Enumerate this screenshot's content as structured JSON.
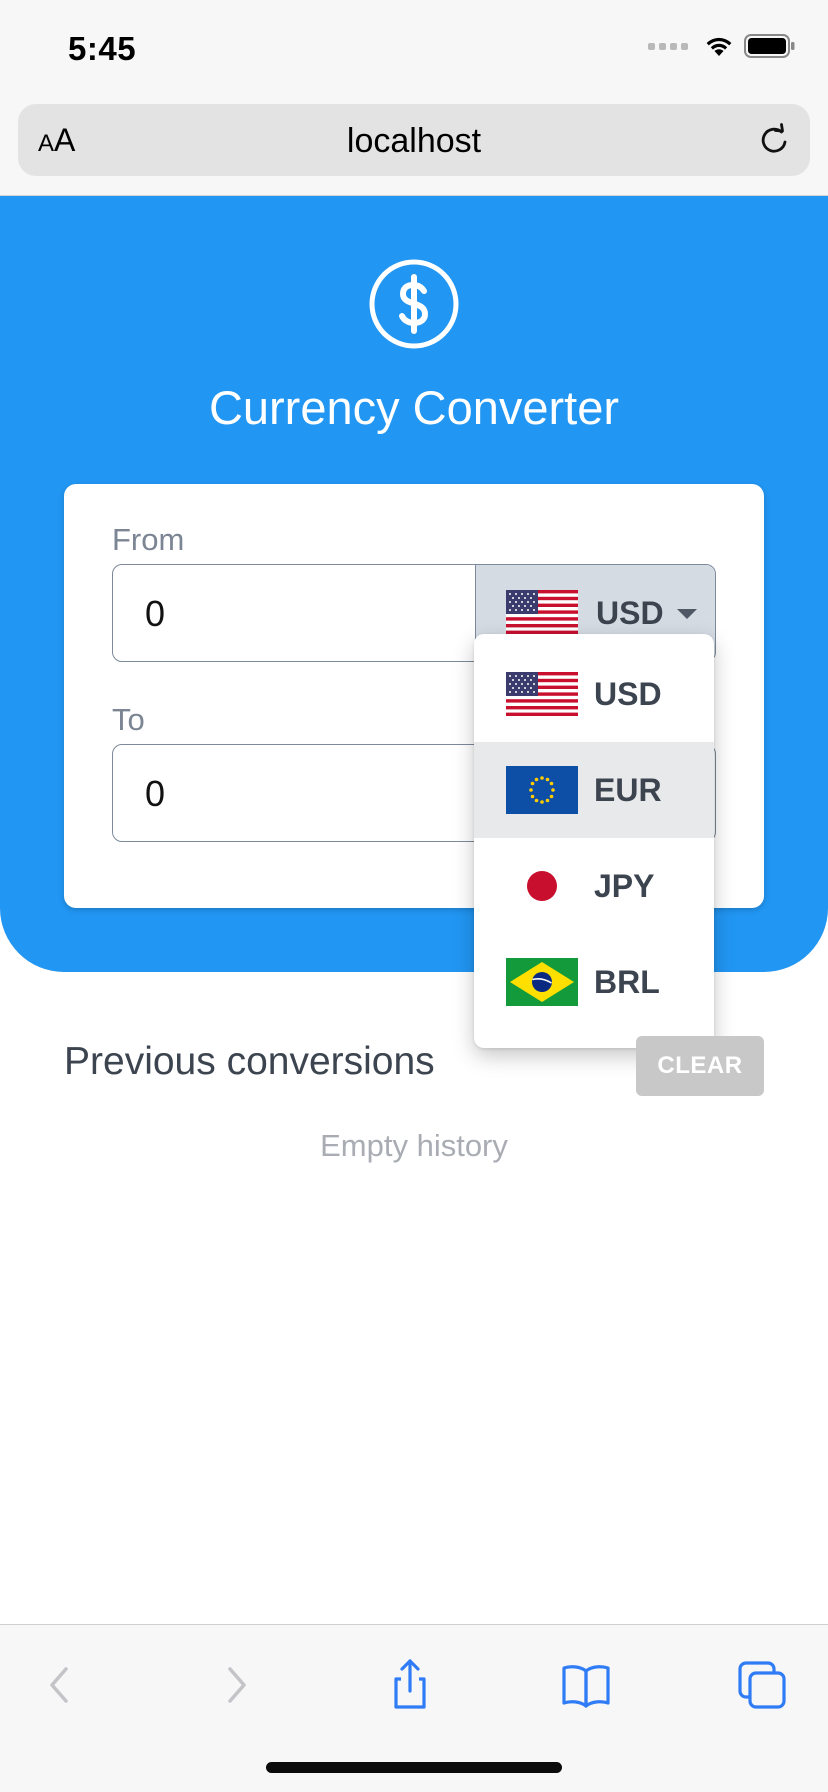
{
  "status_bar": {
    "time": "5:45"
  },
  "browser": {
    "aa_small": "A",
    "aa_large": "A",
    "url": "localhost"
  },
  "app": {
    "title": "Currency Converter"
  },
  "converter": {
    "from_label": "From",
    "from_amount": "0",
    "from_currency": "USD",
    "to_label": "To",
    "to_amount": "0"
  },
  "dropdown": {
    "options": [
      {
        "code": "USD",
        "flag": "us-flag-icon"
      },
      {
        "code": "EUR",
        "flag": "eu-flag-icon",
        "highlighted": true
      },
      {
        "code": "JPY",
        "flag": "jp-flag-icon"
      },
      {
        "code": "BRL",
        "flag": "br-flag-icon"
      }
    ]
  },
  "history": {
    "title": "Previous conversions",
    "clear_label": "CLEAR",
    "empty_text": "Empty history"
  },
  "colors": {
    "primary": "#2196f3",
    "card_bg": "#ffffff",
    "select_bg": "#d4dbe3",
    "clear_disabled": "#c8c8c8",
    "ios_accent": "#2f7cf6"
  }
}
